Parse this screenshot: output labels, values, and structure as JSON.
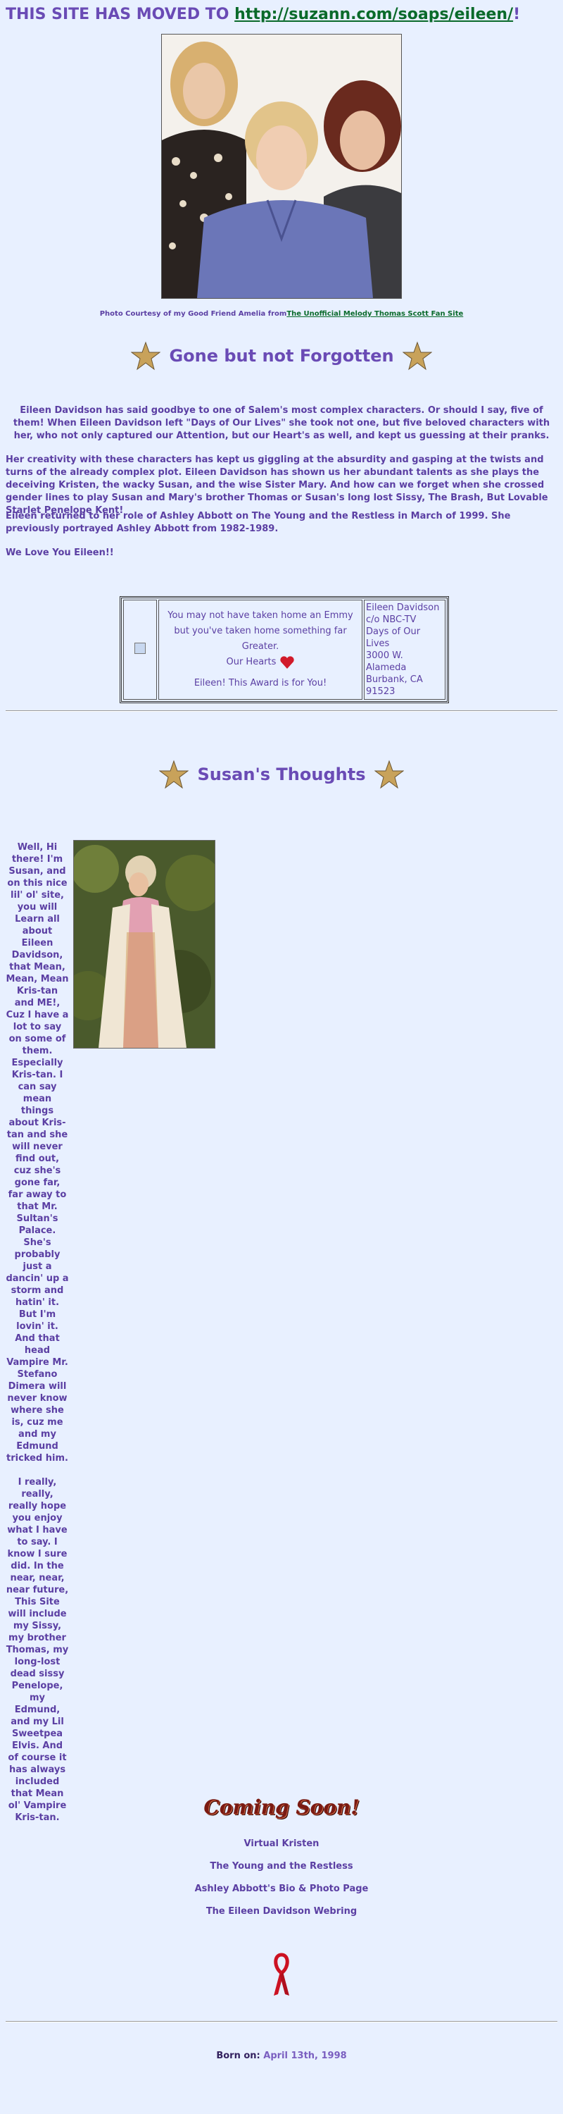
{
  "moved_notice": {
    "prefix": "THIS SITE HAS MOVED TO ",
    "link": "http://suzann.com/soaps/eileen/",
    "suffix": "!"
  },
  "photo_credit": {
    "prefix": "Photo Courtesy of my Good Friend Amelia from",
    "link": "The Unofficial Melody Thomas Scott Fan Site"
  },
  "section1": {
    "title": "Gone but not Forgotten"
  },
  "paragraphs": [
    "Eileen Davidson has said goodbye to one of Salem's most complex characters. Or should I say, five of them! When Eileen Davidson left \"Days of Our Lives\" she took not one, but five beloved characters with her, who not only captured our Attention, but our Heart's as well, and kept us guessing at their pranks.",
    "Her creativity with these characters has kept us giggling at the absurdity and gasping at the twists and turns of the already complex plot. Eileen Davidson has shown us her abundant talents as she plays the deceiving Kristen, the wacky Susan, and the wise Sister Mary. And how can we forget when she crossed gender lines to play Susan and Mary's brother Thomas or Susan's long lost Sissy, The Brash, But Lovable Starlet Penelope Kent!",
    "Eileen returned to her role of Ashley Abbott on The Young and the Restless in March of 1999. She previously portrayed Ashley Abbott from 1982-1989.",
    "We Love You Eileen!!"
  ],
  "award": {
    "line1": "You may not have taken home an Emmy",
    "line2": "but you've taken home something far Greater.",
    "line3": "Our Hearts",
    "line4": "Eileen! This Award is for You!",
    "address": [
      "Eileen Davidson",
      "c/o NBC-TV",
      "Days of Our Lives",
      "3000 W. Alameda",
      "Burbank, CA",
      "91523"
    ]
  },
  "section2": {
    "title": "Susan's Thoughts"
  },
  "susan_text": [
    "Well, Hi there! I'm Susan, and on this nice lil' ol' site, you will Learn all about Eileen Davidson, that Mean, Mean, Mean Kris-tan and ME!, Cuz I have a lot to say on some of them. Especially Kris-tan. I can say mean things about Kris-tan and she will never find out, cuz she's gone far, far away to that Mr. Sultan's Palace. She's probably just a dancin' up a storm and hatin' it. But I'm lovin' it. And that head Vampire Mr. Stefano Dimera will never know where she is, cuz me and my Edmund tricked him.",
    "I really, really, really hope you enjoy what I have to say. I know I sure did. In the near, near, near future, This Site will include my Sissy, my brother Thomas, my long-lost dead sissy Penelope, my Edmund, and my Lil Sweetpea Elvis. And of course it has always included that Mean ol' Vampire Kris-tan."
  ],
  "coming_soon": "Coming Soon!",
  "coming_links": [
    "Virtual Kristen",
    "The Young and the Restless",
    "Ashley Abbott's Bio & Photo Page",
    "The Eileen Davidson Webring"
  ],
  "born": {
    "label": "Born on:",
    "value": "April 13th, 1998"
  },
  "colors": {
    "background": "#e8f0ff",
    "text": "#5b3fa3",
    "link": "#0a6a2a",
    "ribbon": "#cc1122"
  },
  "icons": [
    "star-icon",
    "heart-icon",
    "broken-image-icon",
    "red-ribbon-icon"
  ]
}
